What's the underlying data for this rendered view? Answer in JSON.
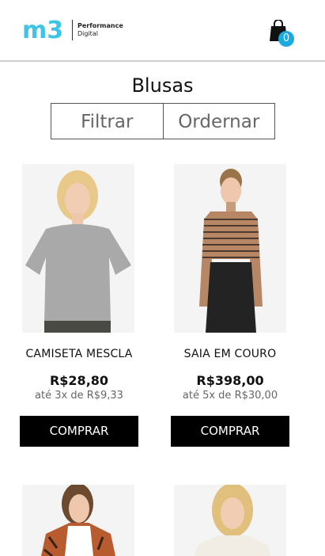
{
  "header": {
    "logo_mark": "m3",
    "logo_line1": "Performance",
    "logo_line2": "Digital",
    "cart_count": "0",
    "accent_color": "#1aa9e1"
  },
  "page": {
    "title": "Blusas"
  },
  "toolbar": {
    "filter_label": "Filtrar",
    "sort_label": "Ordernar"
  },
  "products": [
    {
      "name": "CAMISETA MESCLA",
      "price": "R$28,80",
      "installments": "até 3x de R$9,33",
      "buy_label": "COMPRAR"
    },
    {
      "name": "SAIA EM COURO",
      "price": "R$398,00",
      "installments": "até 5x de R$30,00",
      "buy_label": "COMPRAR"
    }
  ]
}
